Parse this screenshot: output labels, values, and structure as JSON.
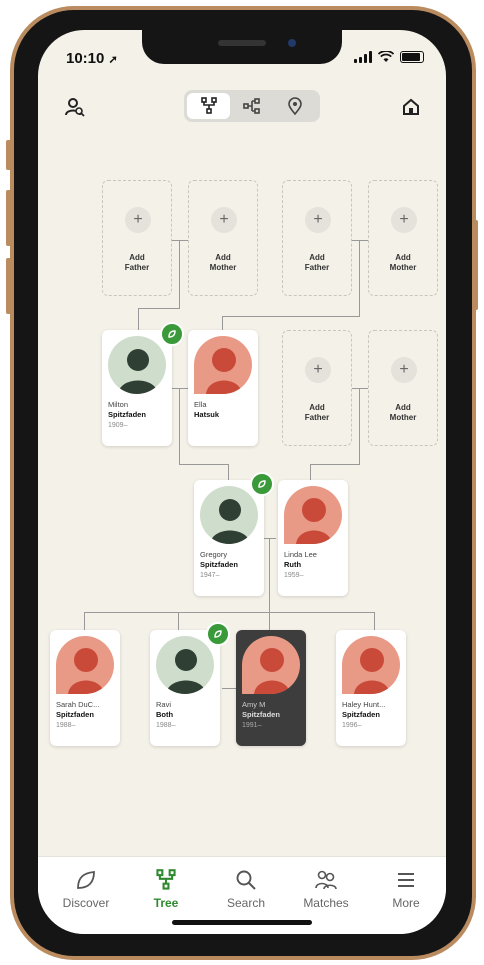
{
  "status_bar": {
    "time": "10:10"
  },
  "top_bar": {
    "view_toggle": [
      {
        "name": "family-view",
        "icon": "family-tree-icon",
        "active": true
      },
      {
        "name": "pedigree-view",
        "icon": "pedigree-icon",
        "active": false
      },
      {
        "name": "map-view",
        "icon": "location-pin-icon",
        "active": false
      }
    ]
  },
  "placeholders": {
    "add_father_line1": "Add",
    "add_father_line2": "Father",
    "add_mother_line1": "Add",
    "add_mother_line2": "Mother",
    "plus": "+"
  },
  "people": {
    "milton": {
      "first": "Milton",
      "last": "Spitzfaden",
      "year": "1909–"
    },
    "ella": {
      "first": "Ella",
      "last": "Hatsuk",
      "year": ""
    },
    "gregory": {
      "first": "Gregory",
      "last": "Spitzfaden",
      "year": "1947–"
    },
    "linda": {
      "first": "Linda Lee",
      "last": "Ruth",
      "year": "1959–"
    },
    "sarah": {
      "first": "Sarah DuC...",
      "last": "Spitzfaden",
      "year": "1988–"
    },
    "ravi": {
      "first": "Ravi",
      "last": "Both",
      "year": "1988–"
    },
    "amy": {
      "first": "Amy M",
      "last": "Spitzfaden",
      "year": "1991–"
    },
    "haley": {
      "first": "Haley Hunt...",
      "last": "Spitzfaden",
      "year": "1996–"
    }
  },
  "tabbar": {
    "discover": "Discover",
    "tree": "Tree",
    "search": "Search",
    "matches": "Matches",
    "more": "More"
  },
  "colors": {
    "accent_green": "#2f8a2f",
    "female_avatar": "#e99a86",
    "male_avatar": "#cfdecc",
    "selected_card": "#3d3d3d"
  }
}
